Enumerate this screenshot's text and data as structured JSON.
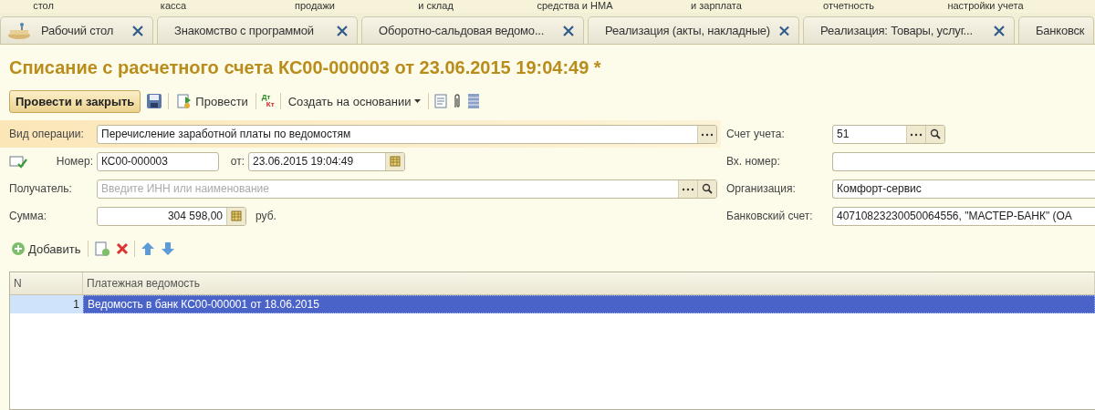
{
  "top_menu": [
    "стол",
    "касса",
    "продажи",
    "и склад",
    "средства и НМА",
    "и зарплата",
    "отчетность",
    "настройки учета"
  ],
  "tabs": [
    {
      "label": "Рабочий стол",
      "kind": "home",
      "closable": true
    },
    {
      "label": "Знакомство с программой",
      "kind": "plain",
      "closable": true
    },
    {
      "label": "Оборотно-сальдовая ведомо...",
      "kind": "plain",
      "closable": true
    },
    {
      "label": "Реализация (акты, накладные)",
      "kind": "plain",
      "closable": true
    },
    {
      "label": "Реализация: Товары, услуг...",
      "kind": "plain",
      "closable": true
    },
    {
      "label": "Банковск",
      "kind": "plain",
      "closable": false
    }
  ],
  "title": "Списание с расчетного счета КС00-000003 от 23.06.2015 19:04:49 *",
  "toolbar": {
    "primary": "Провести и закрыть",
    "post": "Провести",
    "dt": "Дт",
    "kt": "Кт",
    "create_based": "Создать на основании"
  },
  "form_left": [
    {
      "kind": "operation",
      "label": "Вид операции:",
      "value": "Перечисление заработной платы по ведомостям",
      "highlighted": true
    },
    {
      "kind": "number",
      "label": "Номер:",
      "value": "КС00-000003",
      "date_label": "от:",
      "date": "23.06.2015 19:04:49",
      "highlighted": false
    },
    {
      "kind": "lookup",
      "label": "Получатель:",
      "placeholder": "Введите ИНН или наименование",
      "highlighted": false
    },
    {
      "kind": "amount",
      "label": "Сумма:",
      "value": "304 598,00",
      "unit": "руб.",
      "highlighted": false
    }
  ],
  "form_right": [
    {
      "kind": "lookup_short",
      "label": "Счет учета:",
      "value": "51"
    },
    {
      "kind": "text",
      "label": "Вх. номер:"
    },
    {
      "kind": "text",
      "label": "Организация:",
      "value": "Комфорт-сервис"
    },
    {
      "kind": "text",
      "label": "Банковский счет:",
      "value": "40710823230050064556, \"МАСТЕР-БАНК\" (ОА"
    }
  ],
  "table_toolbar": {
    "add": "Добавить"
  },
  "table": {
    "columns": [
      "N",
      "Платежная ведомость"
    ],
    "rows": [
      {
        "n": "1",
        "doc": "Ведомость в банк КС00-000001 от 18.06.2015",
        "selected": true
      }
    ]
  }
}
